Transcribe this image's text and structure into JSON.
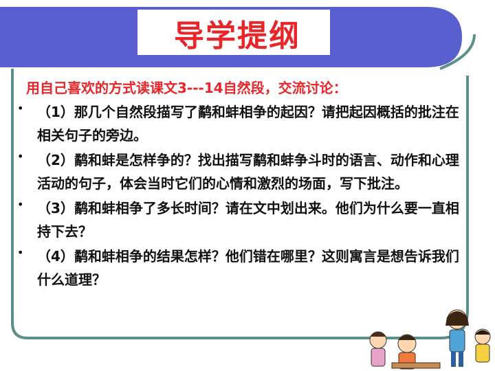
{
  "slide": {
    "title": "导学提纲",
    "intro": "用自己喜欢的方式读课文3---14自然段，交流讨论：",
    "questions": [
      "（1）那几个自然段描写了鹬和蚌相争的起因？请把起因概括的批注在相关句子的旁边。",
      "（2）鹬和蚌是怎样争的？找出描写鹬和蚌争斗时的语言、动作和心理活动的句子，体会当时它们的心情和激烈的场面，写下批注。",
      "（3）鹬和蚌相争了多长时间？请在文中划出来。他们为什么要一直相持下去？",
      "（4）鹬和蚌相争的结果怎样？他们错在哪里？这则寓言是想告诉我们什么道理？"
    ],
    "bullet": "•"
  },
  "colors": {
    "banner": "#5a5fd0",
    "frame": "#5c8f8a",
    "title": "#e8262a",
    "intro": "#e8262a",
    "body_text": "#111111"
  },
  "decoration": "cartoon-children-discussing-illustration"
}
